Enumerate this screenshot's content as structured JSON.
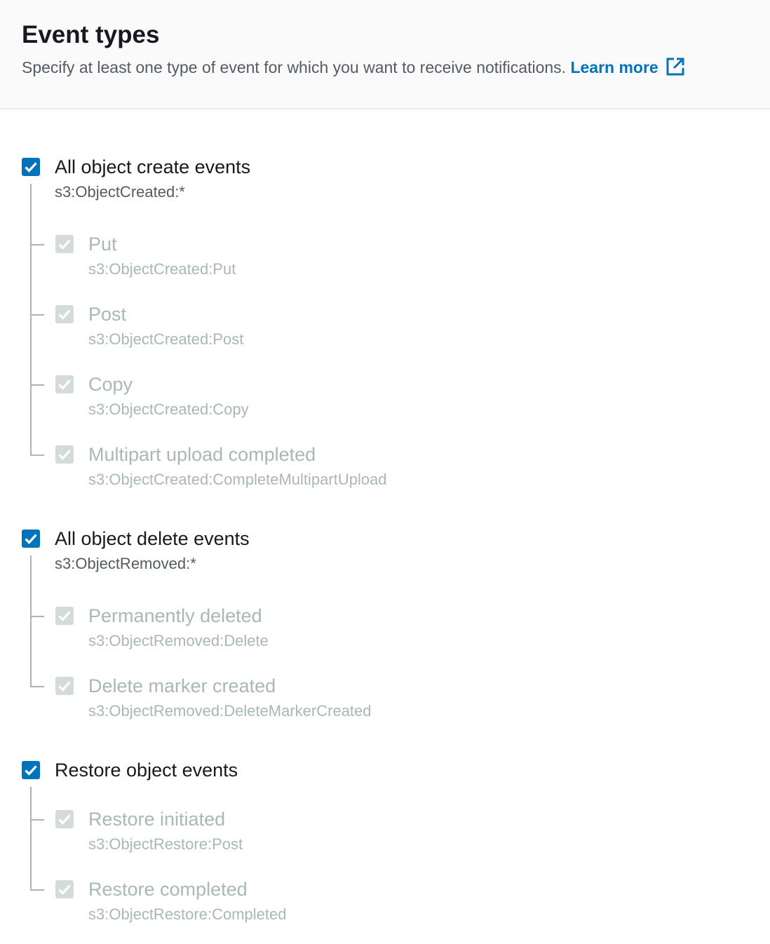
{
  "header": {
    "title": "Event types",
    "description": "Specify at least one type of event for which you want to receive notifications.",
    "learn_more": "Learn more",
    "learn_more_icon": "external-link-icon"
  },
  "colors": {
    "accent": "#0073bb",
    "disabled": "#d5dbdb",
    "disabled_text": "#aab7b8"
  },
  "groups": [
    {
      "label": "All object create events",
      "sub": "s3:ObjectCreated:*",
      "checked": true,
      "children": [
        {
          "label": "Put",
          "sub": "s3:ObjectCreated:Put",
          "checked": true,
          "disabled": true
        },
        {
          "label": "Post",
          "sub": "s3:ObjectCreated:Post",
          "checked": true,
          "disabled": true
        },
        {
          "label": "Copy",
          "sub": "s3:ObjectCreated:Copy",
          "checked": true,
          "disabled": true
        },
        {
          "label": "Multipart upload completed",
          "sub": "s3:ObjectCreated:CompleteMultipartUpload",
          "checked": true,
          "disabled": true
        }
      ]
    },
    {
      "label": "All object delete events",
      "sub": "s3:ObjectRemoved:*",
      "checked": true,
      "children": [
        {
          "label": "Permanently deleted",
          "sub": "s3:ObjectRemoved:Delete",
          "checked": true,
          "disabled": true
        },
        {
          "label": "Delete marker created",
          "sub": "s3:ObjectRemoved:DeleteMarkerCreated",
          "checked": true,
          "disabled": true
        }
      ]
    },
    {
      "label": "Restore object events",
      "sub": "",
      "checked": true,
      "children": [
        {
          "label": "Restore initiated",
          "sub": "s3:ObjectRestore:Post",
          "checked": true,
          "disabled": true
        },
        {
          "label": "Restore completed",
          "sub": "s3:ObjectRestore:Completed",
          "checked": true,
          "disabled": true
        }
      ]
    }
  ]
}
